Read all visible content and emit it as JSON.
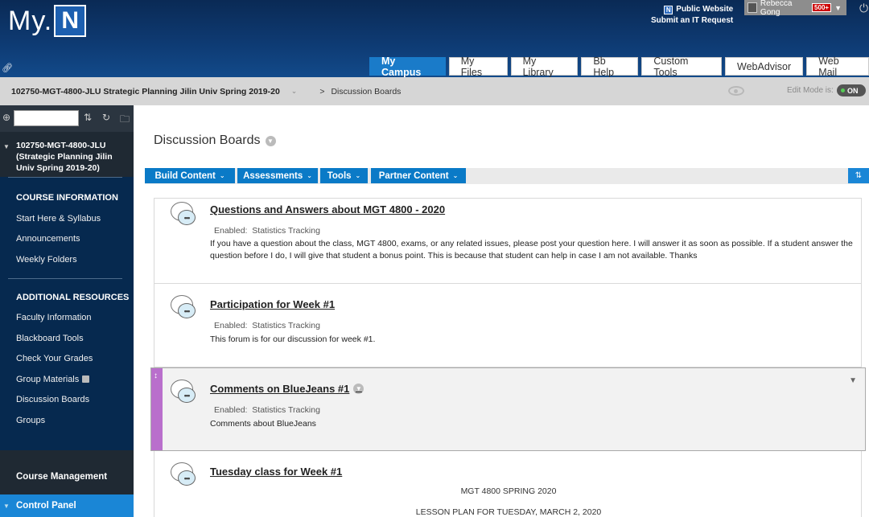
{
  "header": {
    "logo_text": "My.",
    "logo_letter": "N",
    "public_website": "Public Website",
    "it_request": "Submit an IT Request",
    "user_name": "Rebecca Gong",
    "notification_badge": "500+",
    "tabs": [
      {
        "label": "My Campus",
        "active": true
      },
      {
        "label": "My Files",
        "active": false
      },
      {
        "label": "My Library",
        "active": false
      },
      {
        "label": "Bb Help",
        "active": false
      },
      {
        "label": "Custom Tools",
        "active": false
      },
      {
        "label": "WebAdvisor",
        "active": false
      },
      {
        "label": "Web Mail",
        "active": false
      }
    ]
  },
  "breadcrumb": {
    "course": "102750-MGT-4800-JLU Strategic Planning Jilin Univ Spring 2019-20",
    "separator": ">",
    "page": "Discussion Boards",
    "edit_mode_label": "Edit Mode is:",
    "edit_mode_value": "ON"
  },
  "sidebar": {
    "course_title": "102750-MGT-4800-JLU (Strategic Planning Jilin Univ Spring 2019-20)",
    "sections": [
      {
        "heading": "COURSE INFORMATION",
        "items": [
          "Start Here & Syllabus",
          "Announcements",
          "Weekly Folders"
        ]
      },
      {
        "heading": "ADDITIONAL RESOURCES",
        "items": [
          "Faculty Information",
          "Blackboard Tools",
          "Check Your Grades",
          "Group Materials",
          "Discussion Boards",
          "Groups"
        ]
      }
    ],
    "course_management": "Course Management",
    "control_panel": "Control Panel"
  },
  "main": {
    "title": "Discussion Boards",
    "actions": [
      "Build Content",
      "Assessments",
      "Tools",
      "Partner Content"
    ],
    "forums": [
      {
        "title": "Questions and Answers about MGT 4800 - 2020",
        "enabled": "Enabled:",
        "tracking": "Statistics Tracking",
        "description": "If you have a question about the class, MGT 4800, exams, or any related issues, please post your question here.  I will answer it as soon as possible.  If a student answer the question before I do, I will give that student a bonus point.  This is because that student can help in case I am not available.  Thanks"
      },
      {
        "title": "Participation for Week #1",
        "enabled": "Enabled:",
        "tracking": "Statistics Tracking",
        "description": "This forum is for our discussion for week #1."
      },
      {
        "title": "Comments on BlueJeans #1",
        "enabled": "Enabled:",
        "tracking": "Statistics Tracking",
        "description": "Comments about BlueJeans"
      },
      {
        "title": "Tuesday class for Week #1",
        "line1": "MGT 4800 SPRING 2020",
        "line2": "LESSON PLAN FOR TUESDAY, MARCH 2, 2020"
      }
    ]
  },
  "colors": {
    "header_dark": "#0a2a55",
    "tab_active": "#1a7bc9",
    "action_blue": "#0a7ac7",
    "sidebar_nav": "#06294f",
    "drag_purple": "#b96fcc"
  }
}
